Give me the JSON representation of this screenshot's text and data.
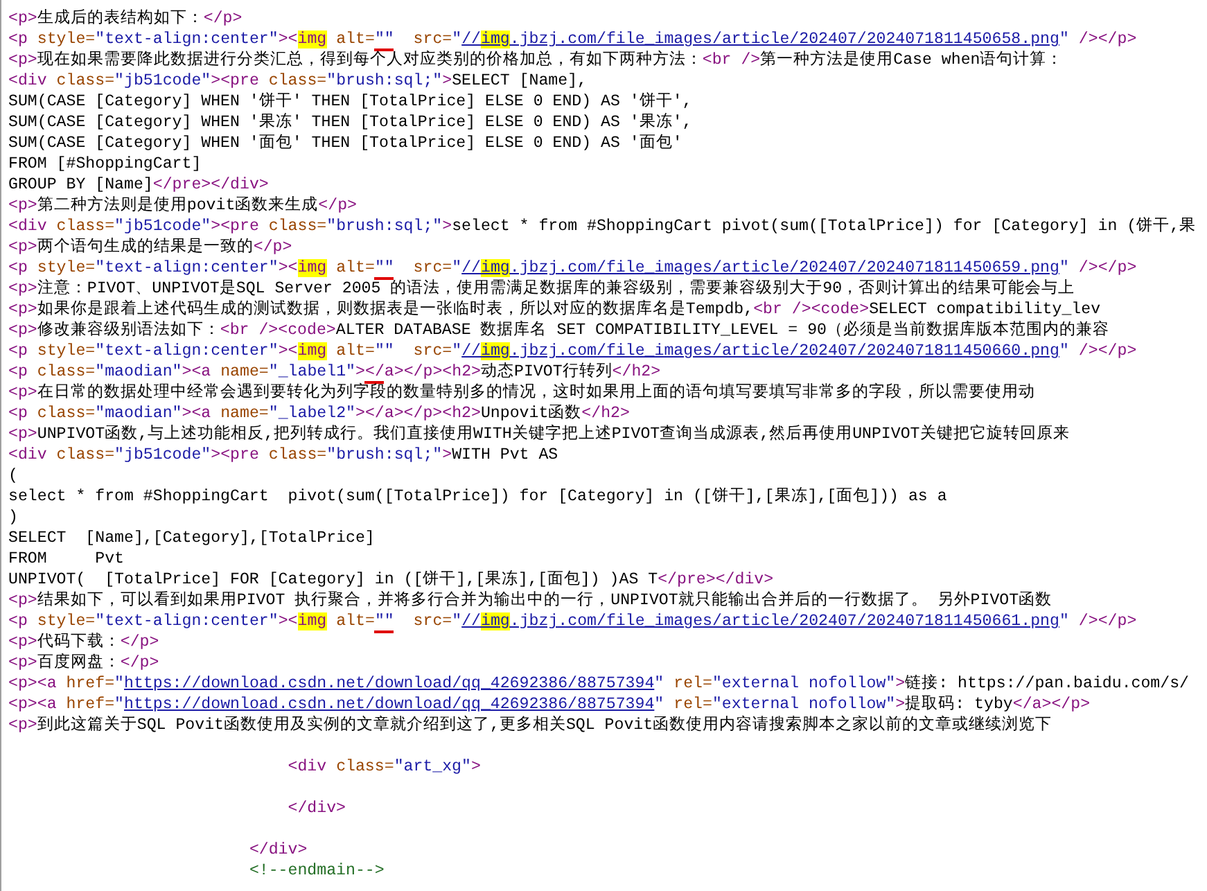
{
  "source_lines": [
    {
      "kind": "code",
      "tokens": [
        {
          "kind": "tag",
          "text": "<p>"
        },
        {
          "kind": "text",
          "text": "生成后的表结构如下："
        },
        {
          "kind": "tag",
          "text": "</p>"
        }
      ]
    },
    {
      "kind": "code",
      "tokens": [
        {
          "kind": "tag",
          "text": "<p "
        },
        {
          "kind": "attr",
          "text": "style="
        },
        {
          "kind": "value",
          "text": "\"text-align:center\""
        },
        {
          "kind": "tag",
          "text": "><"
        },
        {
          "kind": "match",
          "text": "img"
        },
        {
          "kind": "attr",
          "text": " alt="
        },
        {
          "kind": "value-flagged",
          "text": "\"\""
        },
        {
          "kind": "attr",
          "text": "  src="
        },
        {
          "kind": "value",
          "text": "\""
        },
        {
          "kind": "link",
          "text": "//"
        },
        {
          "kind": "link-match",
          "text": "img"
        },
        {
          "kind": "link",
          "text": ".jbzj.com/file_images/article/202407/2024071811450658.png"
        },
        {
          "kind": "value",
          "text": "\""
        },
        {
          "kind": "tag",
          "text": " /></p>"
        }
      ]
    },
    {
      "kind": "code",
      "tokens": [
        {
          "kind": "tag",
          "text": "<p>"
        },
        {
          "kind": "text",
          "text": "现在如果需要降此数据进行分类汇总，得到每个人对应类别的价格加总，有如下两种方法："
        },
        {
          "kind": "tag",
          "text": "<br />"
        },
        {
          "kind": "text",
          "text": "第一种方法是使用Case when语句计算："
        }
      ]
    },
    {
      "kind": "code",
      "tokens": [
        {
          "kind": "tag",
          "text": "<div "
        },
        {
          "kind": "attr",
          "text": "class="
        },
        {
          "kind": "value",
          "text": "\"jb51code\""
        },
        {
          "kind": "tag",
          "text": "><pre "
        },
        {
          "kind": "attr",
          "text": "class="
        },
        {
          "kind": "value",
          "text": "\"brush:sql;\""
        },
        {
          "kind": "tag",
          "text": ">"
        },
        {
          "kind": "text",
          "text": "SELECT [Name],"
        }
      ]
    },
    {
      "kind": "code",
      "tokens": [
        {
          "kind": "text",
          "text": "SUM(CASE [Category] WHEN '饼干' THEN [TotalPrice] ELSE 0 END) AS '饼干',"
        }
      ]
    },
    {
      "kind": "code",
      "tokens": [
        {
          "kind": "text",
          "text": "SUM(CASE [Category] WHEN '果冻' THEN [TotalPrice] ELSE 0 END) AS '果冻',"
        }
      ]
    },
    {
      "kind": "code",
      "tokens": [
        {
          "kind": "text",
          "text": "SUM(CASE [Category] WHEN '面包' THEN [TotalPrice] ELSE 0 END) AS '面包'"
        }
      ]
    },
    {
      "kind": "code",
      "tokens": [
        {
          "kind": "text",
          "text": "FROM [#ShoppingCart]"
        }
      ]
    },
    {
      "kind": "code",
      "tokens": [
        {
          "kind": "text",
          "text": "GROUP BY [Name]"
        },
        {
          "kind": "tag",
          "text": "</pre></div>"
        }
      ]
    },
    {
      "kind": "code",
      "tokens": [
        {
          "kind": "tag",
          "text": "<p>"
        },
        {
          "kind": "text",
          "text": "第二种方法则是使用povit函数来生成"
        },
        {
          "kind": "tag",
          "text": "</p>"
        }
      ]
    },
    {
      "kind": "code",
      "tokens": [
        {
          "kind": "tag",
          "text": "<div "
        },
        {
          "kind": "attr",
          "text": "class="
        },
        {
          "kind": "value",
          "text": "\"jb51code\""
        },
        {
          "kind": "tag",
          "text": "><pre "
        },
        {
          "kind": "attr",
          "text": "class="
        },
        {
          "kind": "value",
          "text": "\"brush:sql;\""
        },
        {
          "kind": "tag",
          "text": ">"
        },
        {
          "kind": "text",
          "text": "select * from #ShoppingCart pivot(sum([TotalPrice]) for [Category] in (饼干,果"
        }
      ]
    },
    {
      "kind": "code",
      "tokens": [
        {
          "kind": "tag",
          "text": "<p>"
        },
        {
          "kind": "text",
          "text": "两个语句生成的结果是一致的"
        },
        {
          "kind": "tag",
          "text": "</p>"
        }
      ]
    },
    {
      "kind": "code",
      "tokens": [
        {
          "kind": "tag",
          "text": "<p "
        },
        {
          "kind": "attr",
          "text": "style="
        },
        {
          "kind": "value",
          "text": "\"text-align:center\""
        },
        {
          "kind": "tag",
          "text": "><"
        },
        {
          "kind": "match",
          "text": "img"
        },
        {
          "kind": "attr",
          "text": " alt="
        },
        {
          "kind": "value-flagged",
          "text": "\"\""
        },
        {
          "kind": "attr",
          "text": "  src="
        },
        {
          "kind": "value",
          "text": "\""
        },
        {
          "kind": "link",
          "text": "//"
        },
        {
          "kind": "link-match",
          "text": "img"
        },
        {
          "kind": "link",
          "text": ".jbzj.com/file_images/article/202407/2024071811450659.png"
        },
        {
          "kind": "value",
          "text": "\""
        },
        {
          "kind": "tag",
          "text": " /></p>"
        }
      ]
    },
    {
      "kind": "code",
      "tokens": [
        {
          "kind": "tag",
          "text": "<p>"
        },
        {
          "kind": "text",
          "text": "注意：PIVOT、UNPIVOT是SQL Server 2005 的语法，使用需满足数据库的兼容级别，需要兼容级别大于90，否则计算出的结果可能会与上"
        }
      ]
    },
    {
      "kind": "code",
      "tokens": [
        {
          "kind": "tag",
          "text": "<p>"
        },
        {
          "kind": "text",
          "text": "如果你是跟着上述代码生成的测试数据，则数据表是一张临时表，所以对应的数据库名是Tempdb,"
        },
        {
          "kind": "tag",
          "text": "<br /><code>"
        },
        {
          "kind": "text",
          "text": "SELECT compatibility_lev"
        }
      ]
    },
    {
      "kind": "code",
      "tokens": [
        {
          "kind": "tag",
          "text": "<p>"
        },
        {
          "kind": "text",
          "text": "修改兼容级别语法如下："
        },
        {
          "kind": "tag",
          "text": "<br /><code>"
        },
        {
          "kind": "text",
          "text": "ALTER DATABASE 数据库名 SET COMPATIBILITY_LEVEL = 90（必须是当前数据库版本范围内的兼容"
        }
      ]
    },
    {
      "kind": "code",
      "tokens": [
        {
          "kind": "tag",
          "text": "<p "
        },
        {
          "kind": "attr",
          "text": "style="
        },
        {
          "kind": "value",
          "text": "\"text-align:center\""
        },
        {
          "kind": "tag",
          "text": "><"
        },
        {
          "kind": "match",
          "text": "img"
        },
        {
          "kind": "attr",
          "text": " alt="
        },
        {
          "kind": "value",
          "text": "\"\""
        },
        {
          "kind": "attr",
          "text": "  src="
        },
        {
          "kind": "value",
          "text": "\""
        },
        {
          "kind": "link",
          "text": "//"
        },
        {
          "kind": "link-match",
          "text": "img"
        },
        {
          "kind": "link",
          "text": ".jbzj.com/file_images/article/202407/2024071811450660.png"
        },
        {
          "kind": "value",
          "text": "\""
        },
        {
          "kind": "tag",
          "text": " /></p>"
        }
      ]
    },
    {
      "kind": "code",
      "tokens": [
        {
          "kind": "tag",
          "text": "<p "
        },
        {
          "kind": "attr",
          "text": "class="
        },
        {
          "kind": "value",
          "text": "\"maodian\""
        },
        {
          "kind": "tag",
          "text": "><a "
        },
        {
          "kind": "attr",
          "text": "name="
        },
        {
          "kind": "value",
          "text": "\"_label1\""
        },
        {
          "kind": "tag",
          "text": ">"
        },
        {
          "kind": "tag-flagged",
          "text": "</"
        },
        {
          "kind": "tag",
          "text": "a></p><h2>"
        },
        {
          "kind": "text",
          "text": "动态PIVOT行转列"
        },
        {
          "kind": "tag",
          "text": "</h2>"
        }
      ]
    },
    {
      "kind": "code",
      "tokens": [
        {
          "kind": "tag",
          "text": "<p>"
        },
        {
          "kind": "text",
          "text": "在日常的数据处理中经常会遇到要转化为列字段的数量特别多的情况，这时如果用上面的语句填写要填写非常多的字段，所以需要使用动"
        }
      ]
    },
    {
      "kind": "code",
      "tokens": [
        {
          "kind": "tag",
          "text": "<p "
        },
        {
          "kind": "attr",
          "text": "class="
        },
        {
          "kind": "value",
          "text": "\"maodian\""
        },
        {
          "kind": "tag",
          "text": "><a "
        },
        {
          "kind": "attr",
          "text": "name="
        },
        {
          "kind": "value",
          "text": "\"_label2\""
        },
        {
          "kind": "tag",
          "text": "></a></p><h2>"
        },
        {
          "kind": "text",
          "text": "Unpovit函数"
        },
        {
          "kind": "tag",
          "text": "</h2>"
        }
      ]
    },
    {
      "kind": "code",
      "tokens": [
        {
          "kind": "tag",
          "text": "<p>"
        },
        {
          "kind": "text",
          "text": "UNPIVOT函数,与上述功能相反,把列转成行。我们直接使用WITH关键字把上述PIVOT查询当成源表,然后再使用UNPIVOT关键把它旋转回原来"
        }
      ]
    },
    {
      "kind": "code",
      "tokens": [
        {
          "kind": "tag",
          "text": "<div "
        },
        {
          "kind": "attr",
          "text": "class="
        },
        {
          "kind": "value",
          "text": "\"jb51code\""
        },
        {
          "kind": "tag",
          "text": "><pre "
        },
        {
          "kind": "attr",
          "text": "class="
        },
        {
          "kind": "value",
          "text": "\"brush:sql;\""
        },
        {
          "kind": "tag",
          "text": ">"
        },
        {
          "kind": "text",
          "text": "WITH Pvt AS"
        }
      ]
    },
    {
      "kind": "code",
      "tokens": [
        {
          "kind": "text",
          "text": "("
        }
      ]
    },
    {
      "kind": "code",
      "tokens": [
        {
          "kind": "text",
          "text": "select * from #ShoppingCart  pivot(sum([TotalPrice]) for [Category] in ([饼干],[果冻],[面包])) as a"
        }
      ]
    },
    {
      "kind": "code",
      "tokens": [
        {
          "kind": "text",
          "text": ")"
        }
      ]
    },
    {
      "kind": "code",
      "tokens": [
        {
          "kind": "text",
          "text": "SELECT  [Name],[Category],[TotalPrice]"
        }
      ]
    },
    {
      "kind": "code",
      "tokens": [
        {
          "kind": "text",
          "text": "FROM     Pvt"
        }
      ]
    },
    {
      "kind": "code",
      "tokens": [
        {
          "kind": "text",
          "text": "UNPIVOT(  [TotalPrice] FOR [Category] in ([饼干],[果冻],[面包]) )AS T"
        },
        {
          "kind": "tag",
          "text": "</pre></div>"
        }
      ]
    },
    {
      "kind": "code",
      "tokens": [
        {
          "kind": "tag",
          "text": "<p>"
        },
        {
          "kind": "text",
          "text": "结果如下，可以看到如果用PIVOT 执行聚合，并将多行合并为输出中的一行，UNPIVOT就只能输出合并后的一行数据了。 另外PIVOT函数"
        }
      ]
    },
    {
      "kind": "code",
      "tokens": [
        {
          "kind": "tag",
          "text": "<p "
        },
        {
          "kind": "attr",
          "text": "style="
        },
        {
          "kind": "value",
          "text": "\"text-align:center\""
        },
        {
          "kind": "tag",
          "text": "><"
        },
        {
          "kind": "match",
          "text": "img"
        },
        {
          "kind": "attr",
          "text": " alt="
        },
        {
          "kind": "value-flagged",
          "text": "\"\""
        },
        {
          "kind": "attr",
          "text": "  src="
        },
        {
          "kind": "value",
          "text": "\""
        },
        {
          "kind": "link",
          "text": "//"
        },
        {
          "kind": "link-match",
          "text": "img"
        },
        {
          "kind": "link",
          "text": ".jbzj.com/file_images/article/202407/2024071811450661.png"
        },
        {
          "kind": "value",
          "text": "\""
        },
        {
          "kind": "tag",
          "text": " /></p>"
        }
      ]
    },
    {
      "kind": "code",
      "tokens": [
        {
          "kind": "tag",
          "text": "<p>"
        },
        {
          "kind": "text",
          "text": "代码下载："
        },
        {
          "kind": "tag",
          "text": "</p>"
        }
      ]
    },
    {
      "kind": "code",
      "tokens": [
        {
          "kind": "tag",
          "text": "<p>"
        },
        {
          "kind": "text",
          "text": "百度网盘："
        },
        {
          "kind": "tag",
          "text": "</p>"
        }
      ]
    },
    {
      "kind": "code",
      "tokens": [
        {
          "kind": "tag",
          "text": "<p><a "
        },
        {
          "kind": "attr",
          "text": "href="
        },
        {
          "kind": "value",
          "text": "\""
        },
        {
          "kind": "link",
          "text": "https://download.csdn.net/download/qq_42692386/88757394"
        },
        {
          "kind": "value",
          "text": "\""
        },
        {
          "kind": "attr",
          "text": " rel="
        },
        {
          "kind": "value",
          "text": "\"external nofollow\""
        },
        {
          "kind": "tag",
          "text": ">"
        },
        {
          "kind": "text",
          "text": "链接: https://pan.baidu.com/s/"
        }
      ]
    },
    {
      "kind": "code",
      "tokens": [
        {
          "kind": "tag",
          "text": "<p><a "
        },
        {
          "kind": "attr",
          "text": "href="
        },
        {
          "kind": "value",
          "text": "\""
        },
        {
          "kind": "link",
          "text": "https://download.csdn.net/download/qq_42692386/88757394"
        },
        {
          "kind": "value",
          "text": "\""
        },
        {
          "kind": "attr",
          "text": " rel="
        },
        {
          "kind": "value",
          "text": "\"external nofollow\""
        },
        {
          "kind": "tag",
          "text": ">"
        },
        {
          "kind": "text",
          "text": "提取码: tyby"
        },
        {
          "kind": "tag",
          "text": "</a></p>"
        }
      ]
    },
    {
      "kind": "code",
      "tokens": [
        {
          "kind": "tag",
          "text": "<p>"
        },
        {
          "kind": "text",
          "text": "到此这篇关于SQL Povit函数使用及实例的文章就介绍到这了,更多相关SQL Povit函数使用内容请搜索脚本之家以前的文章或继续浏览下"
        }
      ]
    },
    {
      "kind": "blank"
    },
    {
      "kind": "code",
      "tokens": [
        {
          "kind": "tag",
          "text": "                             <div "
        },
        {
          "kind": "attr",
          "text": "class="
        },
        {
          "kind": "value",
          "text": "\"art_xg\""
        },
        {
          "kind": "tag",
          "text": ">"
        }
      ]
    },
    {
      "kind": "blank"
    },
    {
      "kind": "code",
      "tokens": [
        {
          "kind": "tag",
          "text": "                             </div>"
        }
      ]
    },
    {
      "kind": "blank"
    },
    {
      "kind": "code",
      "tokens": [
        {
          "kind": "tag",
          "text": "                         </div>"
        }
      ]
    },
    {
      "kind": "code",
      "tokens": [
        {
          "kind": "comment",
          "text": "                         <!--endmain-->"
        }
      ]
    }
  ]
}
